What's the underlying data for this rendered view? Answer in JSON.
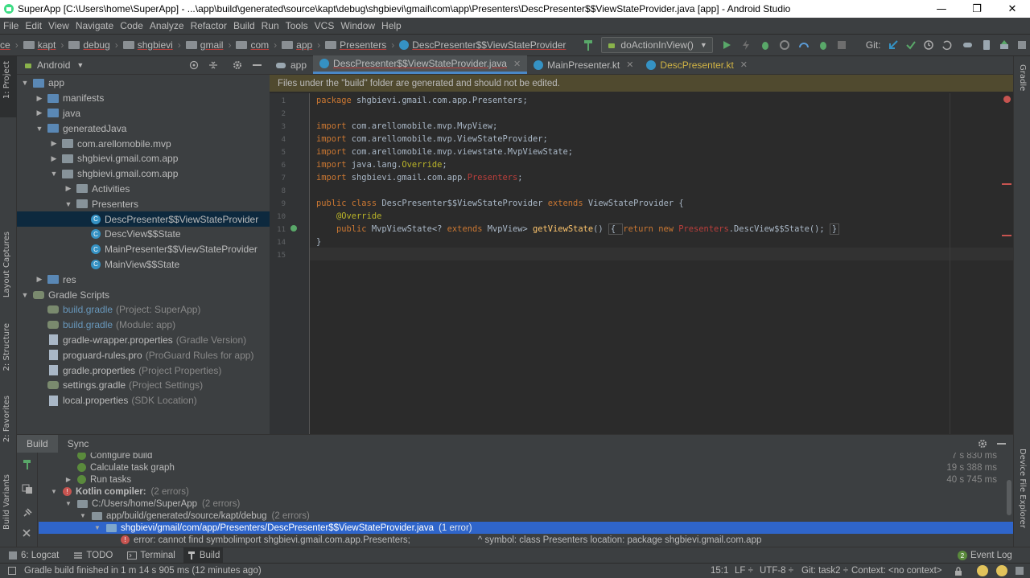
{
  "window": {
    "title": "SuperApp [C:\\Users\\home\\SuperApp] - ...\\app\\build\\generated\\source\\kapt\\debug\\shgbievi\\gmail\\com\\app\\Presenters\\DescPresenter$$ViewStateProvider.java [app] - Android Studio",
    "minimize": "—",
    "maximize": "❐",
    "close": "✕"
  },
  "menu": [
    "File",
    "Edit",
    "View",
    "Navigate",
    "Code",
    "Analyze",
    "Refactor",
    "Build",
    "Run",
    "Tools",
    "VCS",
    "Window",
    "Help"
  ],
  "breadcrumbs": [
    "ce",
    "kapt",
    "debug",
    "shgbievi",
    "gmail",
    "com",
    "app",
    "Presenters",
    "DescPresenter$$ViewStateProvider"
  ],
  "toolbar": {
    "run_config": "doActionInView()",
    "git_label": "Git:"
  },
  "left_strip": {
    "project": "1: Project",
    "layout_captures": "Layout Captures",
    "structure": "2: Structure",
    "favorites": "2: Favorites",
    "build_variants": "Build Variants"
  },
  "right_strip": {
    "gradle": "Gradle",
    "device_file_explorer": "Device File Explorer"
  },
  "project_panel": {
    "view_selector": "Android",
    "tree": [
      {
        "label": "app",
        "depth": 0,
        "toggle": "▼",
        "icon": "folder-blue"
      },
      {
        "label": "manifests",
        "depth": 1,
        "toggle": "▶",
        "icon": "folder-blue"
      },
      {
        "label": "java",
        "depth": 1,
        "toggle": "▶",
        "icon": "folder-blue"
      },
      {
        "label": "generatedJava",
        "depth": 1,
        "toggle": "▼",
        "icon": "folder-blue"
      },
      {
        "label": "com.arellomobile.mvp",
        "depth": 2,
        "toggle": "▶",
        "icon": "folder"
      },
      {
        "label": "shgbievi.gmail.com.app",
        "depth": 2,
        "toggle": "▶",
        "icon": "folder"
      },
      {
        "label": "shgbievi.gmail.com.app",
        "depth": 2,
        "toggle": "▼",
        "icon": "folder"
      },
      {
        "label": "Activities",
        "depth": 3,
        "toggle": "▶",
        "icon": "folder"
      },
      {
        "label": "Presenters",
        "depth": 3,
        "toggle": "▼",
        "icon": "folder"
      },
      {
        "label": "DescPresenter$$ViewStateProvider",
        "depth": 4,
        "toggle": "",
        "icon": "class",
        "selected": true
      },
      {
        "label": "DescView$$State",
        "depth": 4,
        "toggle": "",
        "icon": "class"
      },
      {
        "label": "MainPresenter$$ViewStateProvider",
        "depth": 4,
        "toggle": "",
        "icon": "class"
      },
      {
        "label": "MainView$$State",
        "depth": 4,
        "toggle": "",
        "icon": "class"
      },
      {
        "label": "res",
        "depth": 1,
        "toggle": "▶",
        "icon": "folder-blue"
      },
      {
        "label": "Gradle Scripts",
        "depth": 0,
        "toggle": "▼",
        "icon": "gradle"
      },
      {
        "label": "build.gradle",
        "hint": "(Project: SuperApp)",
        "depth": 1,
        "toggle": "",
        "icon": "gradle",
        "link": true
      },
      {
        "label": "build.gradle",
        "hint": "(Module: app)",
        "depth": 1,
        "toggle": "",
        "icon": "gradle",
        "link": true
      },
      {
        "label": "gradle-wrapper.properties",
        "hint": "(Gradle Version)",
        "depth": 1,
        "toggle": "",
        "icon": "file"
      },
      {
        "label": "proguard-rules.pro",
        "hint": "(ProGuard Rules for app)",
        "depth": 1,
        "toggle": "",
        "icon": "file"
      },
      {
        "label": "gradle.properties",
        "hint": "(Project Properties)",
        "depth": 1,
        "toggle": "",
        "icon": "file"
      },
      {
        "label": "settings.gradle",
        "hint": "(Project Settings)",
        "depth": 1,
        "toggle": "",
        "icon": "gradle"
      },
      {
        "label": "local.properties",
        "hint": "(SDK Location)",
        "depth": 1,
        "toggle": "",
        "icon": "file"
      }
    ]
  },
  "editor": {
    "tabs": [
      {
        "label": "app",
        "active": false
      },
      {
        "label": "DescPresenter$$ViewStateProvider.java",
        "active": true
      },
      {
        "label": "MainPresenter.kt",
        "active": false
      },
      {
        "label": "DescPresenter.kt",
        "active": false
      }
    ],
    "banner": "Files under the \"build\" folder are generated and should not be edited.",
    "lines": [
      {
        "n": "1",
        "parts": [
          {
            "t": "package ",
            "c": "kw"
          },
          {
            "t": "shgbievi.gmail.com.app.Presenters;",
            "c": ""
          }
        ]
      },
      {
        "n": "2",
        "parts": []
      },
      {
        "n": "3",
        "parts": [
          {
            "t": "import ",
            "c": "kw"
          },
          {
            "t": "com.arellomobile.mvp.MvpView;",
            "c": ""
          }
        ]
      },
      {
        "n": "4",
        "parts": [
          {
            "t": "import ",
            "c": "kw"
          },
          {
            "t": "com.arellomobile.mvp.ViewStateProvider;",
            "c": ""
          }
        ]
      },
      {
        "n": "5",
        "parts": [
          {
            "t": "import ",
            "c": "kw"
          },
          {
            "t": "com.arellomobile.mvp.viewstate.MvpViewState;",
            "c": ""
          }
        ]
      },
      {
        "n": "6",
        "parts": [
          {
            "t": "import ",
            "c": "kw"
          },
          {
            "t": "java.lang.",
            "c": ""
          },
          {
            "t": "Override",
            "c": "an"
          },
          {
            "t": ";",
            "c": ""
          }
        ]
      },
      {
        "n": "7",
        "parts": [
          {
            "t": "import ",
            "c": "kw"
          },
          {
            "t": "shgbievi.gmail.com.app.",
            "c": ""
          },
          {
            "t": "Presenters",
            "c": "err"
          },
          {
            "t": ";",
            "c": ""
          }
        ]
      },
      {
        "n": "8",
        "parts": []
      },
      {
        "n": "9",
        "parts": [
          {
            "t": "public class ",
            "c": "kw"
          },
          {
            "t": "DescPresenter$$ViewStateProvider ",
            "c": ""
          },
          {
            "t": "extends ",
            "c": "kw"
          },
          {
            "t": "ViewStateProvider {",
            "c": ""
          }
        ]
      },
      {
        "n": "10",
        "parts": [
          {
            "t": "    ",
            "c": ""
          },
          {
            "t": "@Override",
            "c": "an"
          }
        ]
      },
      {
        "n": "11",
        "parts": [
          {
            "t": "    ",
            "c": ""
          },
          {
            "t": "public ",
            "c": "kw"
          },
          {
            "t": "MvpViewState<? ",
            "c": ""
          },
          {
            "t": "extends ",
            "c": "kw"
          },
          {
            "t": "MvpView> ",
            "c": ""
          },
          {
            "t": "getViewState",
            "c": "mth"
          },
          {
            "t": "() ",
            "c": ""
          },
          {
            "t": "{ ",
            "c": "fold"
          },
          {
            "t": "return new ",
            "c": "kw"
          },
          {
            "t": "Presenters",
            "c": "err"
          },
          {
            "t": ".DescView$$State(); ",
            "c": ""
          },
          {
            "t": "}",
            "c": "fold"
          }
        ]
      },
      {
        "n": "14",
        "parts": [
          {
            "t": "}",
            "c": ""
          }
        ]
      },
      {
        "n": "15",
        "parts": []
      }
    ]
  },
  "build_panel": {
    "tabs": [
      "Build",
      "Sync"
    ],
    "items": [
      {
        "label": "Configure build",
        "depth": 2,
        "toggle": "",
        "icon": "ok",
        "time": "7 s 830 ms"
      },
      {
        "label": "Calculate task graph",
        "depth": 2,
        "toggle": "",
        "icon": "ok",
        "time": "19 s 388 ms"
      },
      {
        "label": "Run tasks",
        "depth": 2,
        "toggle": "▶",
        "icon": "ok",
        "time": "40 s 745 ms"
      },
      {
        "label": "Kotlin compiler:",
        "hint": "(2 errors)",
        "depth": 1,
        "toggle": "▼",
        "icon": "error",
        "bold": true
      },
      {
        "label": "C:/Users/home/SuperApp",
        "hint": "(2 errors)",
        "depth": 2,
        "toggle": "▼",
        "icon": "folder"
      },
      {
        "label": "app/build/generated/source/kapt/debug",
        "hint": "(2 errors)",
        "depth": 3,
        "toggle": "▼",
        "icon": "folder"
      },
      {
        "label": "shgbievi/gmail/com/app/Presenters/DescPresenter$$ViewStateProvider.java",
        "hint": "(1 error)",
        "depth": 4,
        "toggle": "▼",
        "icon": "file",
        "selected": true
      },
      {
        "label": "error: cannot find symbolimport shgbievi.gmail.com.app.Presenters;",
        "extra": "^  symbol:   class Presenters  location: package shgbievi.gmail.com.app",
        "depth": 5,
        "toggle": "",
        "icon": "error"
      }
    ]
  },
  "tool_windows": {
    "logcat": "6: Logcat",
    "todo": "TODO",
    "terminal": "Terminal",
    "build": "Build",
    "event_log": "Event Log",
    "event_count": "2"
  },
  "status": {
    "message": "Gradle build finished in 1 m 14 s 905 ms (12 minutes ago)",
    "position": "15:1",
    "line_sep": "LF ÷",
    "encoding": "UTF-8 ÷",
    "git": "Git: task2 ÷",
    "context": "Context: <no context>"
  },
  "colors": {
    "accent": "#4a88c7",
    "selection": "#0d293e",
    "build_selection": "#2f65ca",
    "error": "#c75450",
    "ok": "#5a8a3c"
  }
}
